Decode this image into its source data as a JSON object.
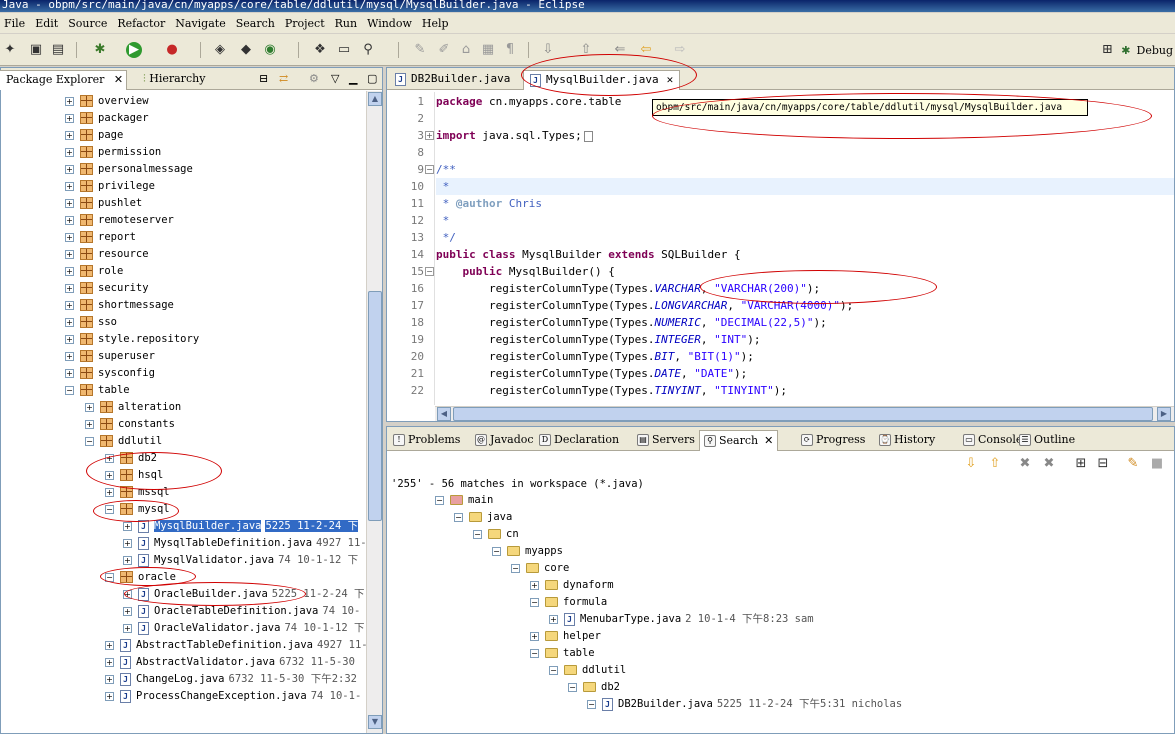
{
  "window": {
    "title": "Java - obpm/src/main/java/cn/myapps/core/table/ddlutil/mysql/MysqlBuilder.java - Eclipse"
  },
  "menu": [
    "File",
    "Edit",
    "Source",
    "Refactor",
    "Navigate",
    "Search",
    "Project",
    "Run",
    "Window",
    "Help"
  ],
  "perspectives": {
    "debug_label": "Debug"
  },
  "left_panel": {
    "tabs": {
      "package_explorer": "Package Explorer",
      "hierarchy": "Hierarchy"
    },
    "tree": [
      {
        "depth": 0,
        "exp": "+",
        "icon": "package",
        "label": "overview"
      },
      {
        "depth": 0,
        "exp": "+",
        "icon": "package",
        "label": "packager"
      },
      {
        "depth": 0,
        "exp": "+",
        "icon": "package",
        "label": "page"
      },
      {
        "depth": 0,
        "exp": "+",
        "icon": "package",
        "label": "permission"
      },
      {
        "depth": 0,
        "exp": "+",
        "icon": "package",
        "label": "personalmessage"
      },
      {
        "depth": 0,
        "exp": "+",
        "icon": "package",
        "label": "privilege"
      },
      {
        "depth": 0,
        "exp": "+",
        "icon": "package",
        "label": "pushlet"
      },
      {
        "depth": 0,
        "exp": "+",
        "icon": "package",
        "label": "remoteserver"
      },
      {
        "depth": 0,
        "exp": "+",
        "icon": "package",
        "label": "report"
      },
      {
        "depth": 0,
        "exp": "+",
        "icon": "package",
        "label": "resource"
      },
      {
        "depth": 0,
        "exp": "+",
        "icon": "package",
        "label": "role"
      },
      {
        "depth": 0,
        "exp": "+",
        "icon": "package",
        "label": "security"
      },
      {
        "depth": 0,
        "exp": "+",
        "icon": "package",
        "label": "shortmessage"
      },
      {
        "depth": 0,
        "exp": "+",
        "icon": "package",
        "label": "sso"
      },
      {
        "depth": 0,
        "exp": "+",
        "icon": "package",
        "label": "style.repository"
      },
      {
        "depth": 0,
        "exp": "+",
        "icon": "package",
        "label": "superuser"
      },
      {
        "depth": 0,
        "exp": "+",
        "icon": "package",
        "label": "sysconfig"
      },
      {
        "depth": 0,
        "exp": "-",
        "icon": "package",
        "label": "table"
      },
      {
        "depth": 1,
        "exp": "+",
        "icon": "package",
        "label": "alteration"
      },
      {
        "depth": 1,
        "exp": "+",
        "icon": "package",
        "label": "constants"
      },
      {
        "depth": 1,
        "exp": "-",
        "icon": "package",
        "label": "ddlutil"
      },
      {
        "depth": 2,
        "exp": "+",
        "icon": "package",
        "label": "db2"
      },
      {
        "depth": 2,
        "exp": "+",
        "icon": "package",
        "label": "hsql"
      },
      {
        "depth": 2,
        "exp": "+",
        "icon": "package",
        "label": "mssql"
      },
      {
        "depth": 2,
        "exp": "-",
        "icon": "package",
        "label": "mysql"
      },
      {
        "depth": 3,
        "exp": "+",
        "icon": "java",
        "label": "MysqlBuilder.java",
        "meta": "5225  11-2-24 下",
        "selected": true
      },
      {
        "depth": 3,
        "exp": "+",
        "icon": "java",
        "label": "MysqlTableDefinition.java",
        "meta": "4927  11-"
      },
      {
        "depth": 3,
        "exp": "+",
        "icon": "java",
        "label": "MysqlValidator.java",
        "meta": "74  10-1-12 下"
      },
      {
        "depth": 2,
        "exp": "-",
        "icon": "package",
        "label": "oracle"
      },
      {
        "depth": 3,
        "exp": "+",
        "icon": "java",
        "label": "OracleBuilder.java",
        "meta": "5225  11-2-24 下"
      },
      {
        "depth": 3,
        "exp": "+",
        "icon": "java",
        "label": "OracleTableDefinition.java",
        "meta": "74  10-"
      },
      {
        "depth": 3,
        "exp": "+",
        "icon": "java",
        "label": "OracleValidator.java",
        "meta": "74  10-1-12 下"
      },
      {
        "depth": 2,
        "exp": "+",
        "icon": "java",
        "label": "AbstractTableDefinition.java",
        "meta": "4927  11-"
      },
      {
        "depth": 2,
        "exp": "+",
        "icon": "java",
        "label": "AbstractValidator.java",
        "meta": "6732  11-5-30 "
      },
      {
        "depth": 2,
        "exp": "+",
        "icon": "java",
        "label": "ChangeLog.java",
        "meta": "6732  11-5-30 下午2:32"
      },
      {
        "depth": 2,
        "exp": "+",
        "icon": "java",
        "label": "ProcessChangeException.java",
        "meta": "74  10-1-"
      }
    ]
  },
  "editor": {
    "tabs": [
      {
        "label": "DB2Builder.java",
        "active": false
      },
      {
        "label": "MysqlBuilder.java",
        "active": true
      }
    ],
    "tooltip": "obpm/src/main/java/cn/myapps/core/table/ddlutil/mysql/MysqlBuilder.java",
    "line_numbers": [
      "1",
      "2",
      "3",
      "8",
      "9",
      "10",
      "11",
      "12",
      "13",
      "14",
      "15",
      "16",
      "17",
      "18",
      "19",
      "20",
      "21",
      "22"
    ],
    "lines": [
      [
        [
          "kw",
          "package"
        ],
        [
          "",
          " cn.myapps.core.table"
        ]
      ],
      [],
      [
        [
          "kw",
          "import"
        ],
        [
          "",
          " java.sql.Types;"
        ],
        [
          "box",
          " "
        ]
      ],
      [],
      [
        [
          "com",
          "/**"
        ]
      ],
      [
        [
          "com",
          " *"
        ]
      ],
      [
        [
          "com",
          " * "
        ],
        [
          "tag",
          "@author"
        ],
        [
          "com",
          " Chris"
        ]
      ],
      [
        [
          "com",
          " *"
        ]
      ],
      [
        [
          "com",
          " */"
        ]
      ],
      [
        [
          "kw",
          "public class"
        ],
        [
          "",
          " MysqlBuilder "
        ],
        [
          "kw",
          "extends"
        ],
        [
          "",
          " SQLBuilder {"
        ]
      ],
      [
        [
          "",
          "    "
        ],
        [
          "kw",
          "public"
        ],
        [
          "",
          " MysqlBuilder() {"
        ]
      ],
      [
        [
          "",
          "        registerColumnType(Types."
        ],
        [
          "fld",
          "VARCHAR"
        ],
        [
          "",
          ", "
        ],
        [
          "str",
          "\"VARCHAR(200)\""
        ],
        [
          "",
          ");"
        ]
      ],
      [
        [
          "",
          "        registerColumnType(Types."
        ],
        [
          "fld",
          "LONGVARCHAR"
        ],
        [
          "",
          ", "
        ],
        [
          "str",
          "\"VARCHAR(4000)\""
        ],
        [
          "",
          ");"
        ]
      ],
      [
        [
          "",
          "        registerColumnType(Types."
        ],
        [
          "fld",
          "NUMERIC"
        ],
        [
          "",
          ", "
        ],
        [
          "str",
          "\"DECIMAL(22,5)\""
        ],
        [
          "",
          ");"
        ]
      ],
      [
        [
          "",
          "        registerColumnType(Types."
        ],
        [
          "fld",
          "INTEGER"
        ],
        [
          "",
          ", "
        ],
        [
          "str",
          "\"INT\""
        ],
        [
          "",
          ");"
        ]
      ],
      [
        [
          "",
          "        registerColumnType(Types."
        ],
        [
          "fld",
          "BIT"
        ],
        [
          "",
          ", "
        ],
        [
          "str",
          "\"BIT(1)\""
        ],
        [
          "",
          ");"
        ]
      ],
      [
        [
          "",
          "        registerColumnType(Types."
        ],
        [
          "fld",
          "DATE"
        ],
        [
          "",
          ", "
        ],
        [
          "str",
          "\"DATE\""
        ],
        [
          "",
          ");"
        ]
      ],
      [
        [
          "",
          "        registerColumnType(Types."
        ],
        [
          "fld",
          "TINYINT"
        ],
        [
          "",
          ", "
        ],
        [
          "str",
          "\"TINYINT\""
        ],
        [
          "",
          ");"
        ]
      ]
    ]
  },
  "bottom_panel": {
    "tabs": [
      {
        "label": "Problems",
        "active": false
      },
      {
        "label": "Javadoc",
        "active": false
      },
      {
        "label": "Declaration",
        "active": false
      },
      {
        "label": "Servers",
        "active": false
      },
      {
        "label": "Search",
        "active": true
      },
      {
        "label": "Progress",
        "active": false
      },
      {
        "label": "History",
        "active": false
      },
      {
        "label": "Console",
        "active": false
      },
      {
        "label": "Outline",
        "active": false
      }
    ],
    "summary": "'255' - 56 matches in workspace (*.java)",
    "results": [
      {
        "depth": 0,
        "exp": "-",
        "icon": "srcfolder",
        "label": "main"
      },
      {
        "depth": 1,
        "exp": "-",
        "icon": "folder",
        "label": "java"
      },
      {
        "depth": 2,
        "exp": "-",
        "icon": "folder",
        "label": "cn"
      },
      {
        "depth": 3,
        "exp": "-",
        "icon": "folder",
        "label": "myapps"
      },
      {
        "depth": 4,
        "exp": "-",
        "icon": "folder",
        "label": "core"
      },
      {
        "depth": 5,
        "exp": "+",
        "icon": "folder",
        "label": "dynaform"
      },
      {
        "depth": 5,
        "exp": "-",
        "icon": "folder",
        "label": "formula"
      },
      {
        "depth": 6,
        "exp": "+",
        "icon": "java",
        "label": "MenubarType.java",
        "meta": "2   10-1-4 下午8:23  sam"
      },
      {
        "depth": 5,
        "exp": "+",
        "icon": "folder",
        "label": "helper"
      },
      {
        "depth": 5,
        "exp": "-",
        "icon": "folder",
        "label": "table"
      },
      {
        "depth": 6,
        "exp": "-",
        "icon": "folder",
        "label": "ddlutil"
      },
      {
        "depth": 7,
        "exp": "-",
        "icon": "folder",
        "label": "db2"
      },
      {
        "depth": 8,
        "exp": "-",
        "icon": "java",
        "label": "DB2Builder.java",
        "meta": "5225  11-2-24 下午5:31  nicholas"
      }
    ]
  },
  "colors": {
    "selection": "#316ac5",
    "keyword": "#7f0055",
    "string": "#2a00ff",
    "comment": "#3f5fbf",
    "annotation": "#d00000"
  }
}
